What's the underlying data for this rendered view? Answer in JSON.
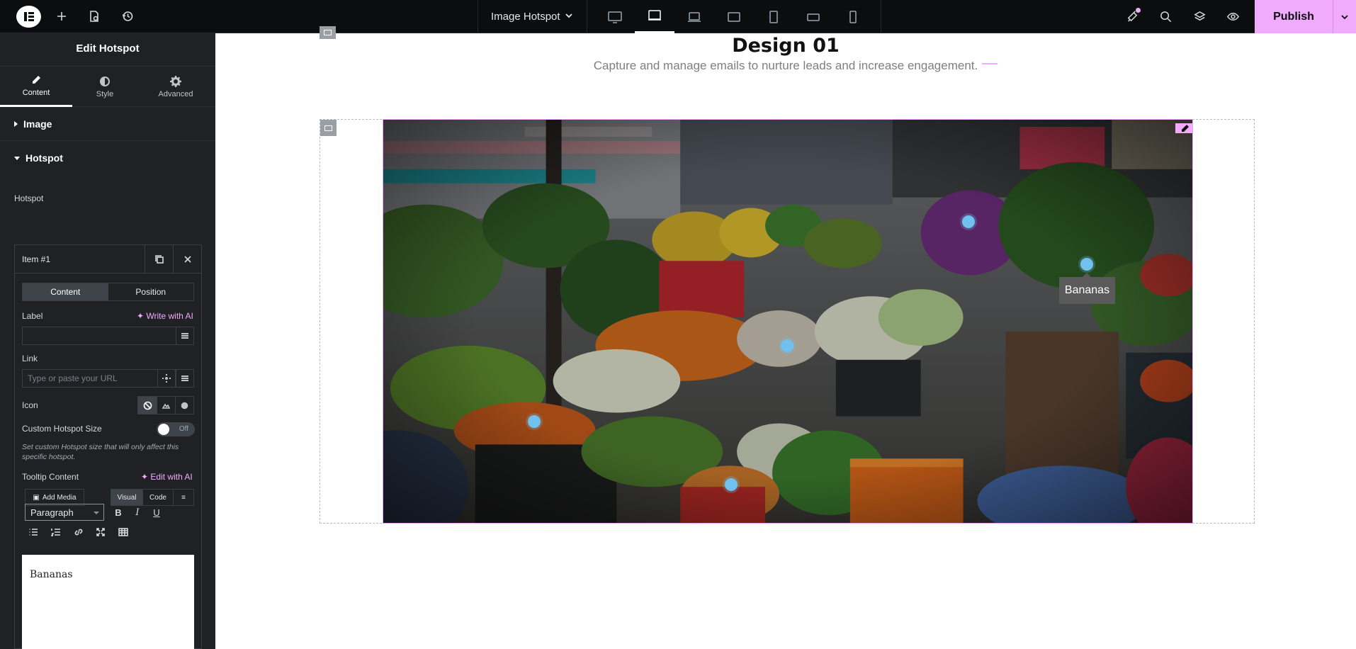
{
  "topbar": {
    "document_title": "Image Hotspot",
    "publish_label": "Publish",
    "icons": [
      "elementor-logo-icon",
      "plus-icon",
      "page-settings-icon",
      "history-icon"
    ],
    "devices": [
      "desktop",
      "tablet",
      "laptop",
      "tablet-extra",
      "tablet-portrait",
      "mobile-extra",
      "mobile"
    ],
    "active_device": "tablet",
    "right_icons": [
      "notifications-icon",
      "search-icon",
      "layers-icon",
      "preview-icon"
    ],
    "accent_color": "#f0abfc"
  },
  "panel": {
    "title": "Edit Hotspot",
    "tabs": [
      {
        "label": "Content",
        "icon": "pencil-icon",
        "active": true
      },
      {
        "label": "Style",
        "icon": "half-circle-icon",
        "active": false
      },
      {
        "label": "Advanced",
        "icon": "gear-icon",
        "active": false
      }
    ],
    "sections": {
      "image": "Image",
      "hotspot": "Hotspot"
    },
    "hotspot_label": "Hotspot",
    "item": {
      "title": "Item #1",
      "inner_tabs": [
        "Content",
        "Position"
      ],
      "label_field": {
        "label": "Label",
        "ai": "Write with AI",
        "value": ""
      },
      "link_field": {
        "label": "Link",
        "placeholder": "Type or paste your URL"
      },
      "icon_field": {
        "label": "Icon"
      },
      "custom_size": {
        "label": "Custom Hotspot Size",
        "toggle": "Off",
        "hint": "Set custom Hotspot size that will only affect this specific hotspot."
      },
      "tooltip": {
        "label": "Tooltip Content",
        "ai": "Edit with AI",
        "add_media": "Add Media",
        "visual": "Visual",
        "code": "Code",
        "format": "Paragraph",
        "content": "Bananas"
      }
    }
  },
  "canvas": {
    "heading": "Design 01",
    "subheading": "Capture and manage emails to nurture leads and increase engagement.",
    "hotspots": [
      {
        "name": "hotspot-1"
      },
      {
        "name": "hotspot-2"
      },
      {
        "name": "hotspot-3"
      },
      {
        "name": "hotspot-4"
      },
      {
        "name": "hotspot-5"
      }
    ],
    "tooltip": "Bananas",
    "hotspot_color": "#71c1ee"
  }
}
